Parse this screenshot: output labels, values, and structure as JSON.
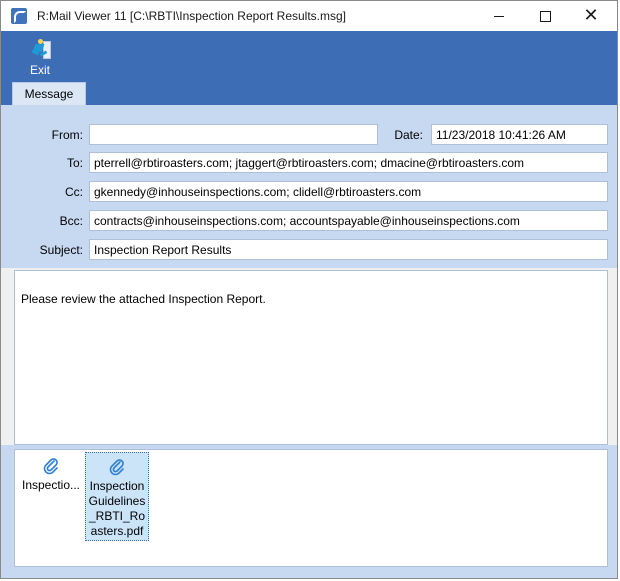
{
  "window": {
    "title": "R:Mail Viewer 11 [C:\\RBTI\\Inspection Report Results.msg]"
  },
  "ribbon": {
    "exit_label": "Exit"
  },
  "tabs": [
    {
      "label": "Message",
      "active": true
    }
  ],
  "message": {
    "from_label": "From:",
    "from_value": "",
    "date_label": "Date:",
    "date_value": "11/23/2018 10:41:26 AM",
    "to_label": "To:",
    "to_value": "pterrell@rbtiroasters.com; jtaggert@rbtiroasters.com; dmacine@rbtiroasters.com",
    "cc_label": "Cc:",
    "cc_value": "gkennedy@inhouseinspections.com; clidell@rbtiroasters.com",
    "bcc_label": "Bcc:",
    "bcc_value": "contracts@inhouseinspections.com; accountspayable@inhouseinspections.com",
    "subject_label": "Subject:",
    "subject_value": "Inspection Report Results",
    "body": "Please review the attached Inspection Report."
  },
  "attachments": [
    {
      "name": "Inspectio...",
      "icon": "paperclip-icon",
      "selected": false
    },
    {
      "name": "InspectionGuidelines_RBTI_Roasters.pdf",
      "icon": "paperclip-icon",
      "selected": true
    }
  ],
  "colors": {
    "ribbon": "#3d6eb5",
    "panel": "#c7d9f1",
    "clip": "#2f7fd4"
  }
}
